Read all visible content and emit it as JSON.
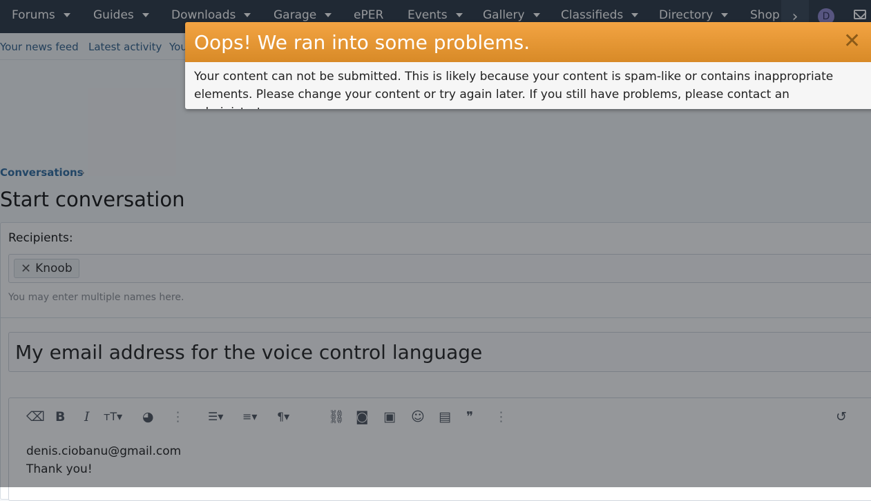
{
  "nav": {
    "items": [
      {
        "label": "Forums",
        "caret": true
      },
      {
        "label": "Guides",
        "caret": true
      },
      {
        "label": "Downloads",
        "caret": true
      },
      {
        "label": "Garage",
        "caret": true
      },
      {
        "label": "ePER",
        "caret": false
      },
      {
        "label": "Events",
        "caret": true
      },
      {
        "label": "Gallery",
        "caret": true
      },
      {
        "label": "Classifieds",
        "caret": true
      },
      {
        "label": "Directory",
        "caret": true
      },
      {
        "label": "Shop",
        "caret": false
      }
    ],
    "more_glyph": "›",
    "avatar_letter": "D"
  },
  "subnav": {
    "items": [
      "Your news feed",
      "Latest activity",
      "You"
    ]
  },
  "breadcrumb": {
    "label": "Conversations",
    "chevron": "›"
  },
  "page_title": "Start conversation",
  "form": {
    "recipients_label": "Recipients:",
    "recipient_token": "Knoob",
    "token_remove_glyph": "✕",
    "recipients_hint": "You may enter multiple names here.",
    "title_value": "My email address for the voice control language",
    "message_lines": [
      "denis.ciobanu@gmail.com",
      "Thank you!"
    ]
  },
  "toolbar": {
    "icons": [
      {
        "name": "eraser-icon",
        "glyph": "⌫"
      },
      {
        "name": "bold-icon",
        "glyph": "B"
      },
      {
        "name": "italic-icon",
        "glyph": "I"
      },
      {
        "name": "font-size-icon",
        "glyph": "тT▾"
      },
      {
        "name": "palette-icon",
        "glyph": "◕"
      },
      {
        "name": "more-vertical-icon",
        "glyph": "⋮"
      },
      {
        "name": "list-icon",
        "glyph": "☰▾"
      },
      {
        "name": "align-icon",
        "glyph": "≡▾"
      },
      {
        "name": "paragraph-icon",
        "glyph": "¶▾"
      },
      {
        "name": "link-icon",
        "glyph": "⛓"
      },
      {
        "name": "camera-icon",
        "glyph": "◙"
      },
      {
        "name": "image-icon",
        "glyph": "▣"
      },
      {
        "name": "smiley-icon",
        "glyph": "☺"
      },
      {
        "name": "media-icon",
        "glyph": "▤"
      },
      {
        "name": "quote-icon",
        "glyph": "❞"
      },
      {
        "name": "more-vertical-icon-2",
        "glyph": "⋮"
      },
      {
        "name": "undo-icon",
        "glyph": "↺"
      }
    ]
  },
  "alert": {
    "title": "Oops! We ran into some problems.",
    "close_glyph": "✕",
    "message": "Your content can not be submitted. This is likely because your content is spam-like or contains inappropriate elements. Please change your content or try again later. If you still have problems, please contact an administrator."
  }
}
